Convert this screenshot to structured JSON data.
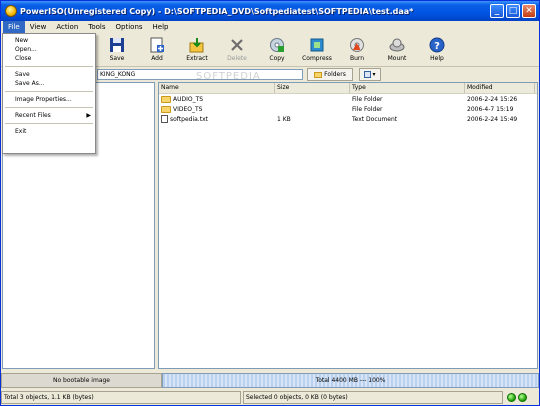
{
  "window": {
    "title": "PowerISO(Unregistered Copy) - D:\\SOFTPEDIA_DVD\\Softpediatest\\SOFTPEDIA\\test.daa*",
    "minimize": "_",
    "maximize": "□",
    "close": "✕"
  },
  "menubar": [
    "File",
    "View",
    "Action",
    "Tools",
    "Options",
    "Help"
  ],
  "file_menu": {
    "items": [
      "New",
      "Open...",
      "Close",
      "Save",
      "Save As...",
      "Image Properties...",
      "Recent Files",
      "Exit"
    ],
    "submenu_arrow": "▶"
  },
  "toolbar": {
    "items": [
      {
        "label": "Save",
        "icon": "save-icon",
        "enabled": true
      },
      {
        "label": "Add",
        "icon": "add-icon",
        "enabled": true
      },
      {
        "label": "Extract",
        "icon": "extract-icon",
        "enabled": true
      },
      {
        "label": "Delete",
        "icon": "delete-icon",
        "enabled": false
      },
      {
        "label": "Copy",
        "icon": "copy-icon",
        "enabled": true
      },
      {
        "label": "Compress",
        "icon": "compress-icon",
        "enabled": true
      },
      {
        "label": "Burn",
        "icon": "burn-icon",
        "enabled": true
      },
      {
        "label": "Mount",
        "icon": "mount-icon",
        "enabled": true
      },
      {
        "label": "Help",
        "icon": "help-icon",
        "enabled": true
      }
    ]
  },
  "address": {
    "value": "KING_KONG"
  },
  "folders_label": "Folders",
  "views_arrow": "▾",
  "watermark": "SOFTPEDIA",
  "list": {
    "columns": [
      "Name",
      "Size",
      "Type",
      "Modified"
    ],
    "rows": [
      {
        "name": "AUDIO_TS",
        "size": "",
        "type": "File Folder",
        "modified": "2006-2-24 15:26",
        "icon": "folder-icon"
      },
      {
        "name": "VIDEO_TS",
        "size": "",
        "type": "File Folder",
        "modified": "2006-4-7 15:19",
        "icon": "folder-icon"
      },
      {
        "name": "softpedia.txt",
        "size": "1 KB",
        "type": "Text Document",
        "modified": "2006-2-24 15:49",
        "icon": "file-icon"
      }
    ]
  },
  "capacity": {
    "label": "No bootable image",
    "bar_text": "Total 4400 MB --- 100%"
  },
  "status": {
    "left": "Total 3 objects, 1.1 KB (bytes)",
    "right": "Selected 0 objects, 0 KB (0 bytes)"
  }
}
